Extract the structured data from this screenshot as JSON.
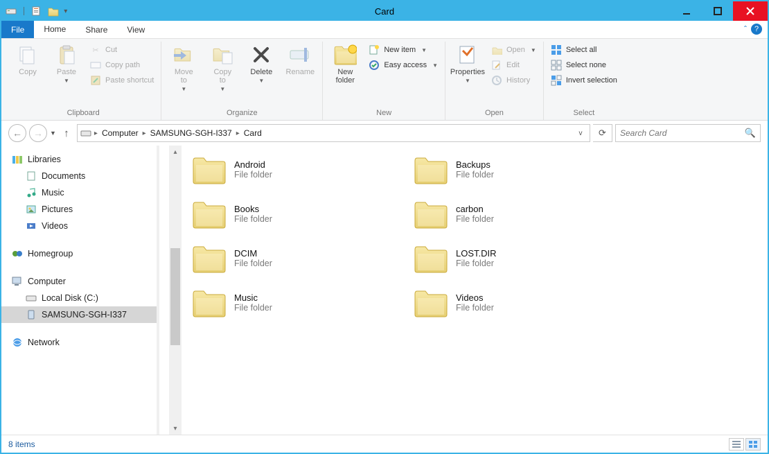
{
  "window": {
    "title": "Card"
  },
  "tabs": {
    "file": "File",
    "home": "Home",
    "share": "Share",
    "view": "View"
  },
  "ribbon": {
    "clipboard": {
      "label": "Clipboard",
      "copy": "Copy",
      "paste": "Paste",
      "cut": "Cut",
      "copy_path": "Copy path",
      "paste_shortcut": "Paste shortcut"
    },
    "organize": {
      "label": "Organize",
      "move_to": "Move\nto",
      "copy_to": "Copy\nto",
      "delete": "Delete",
      "rename": "Rename"
    },
    "new": {
      "label": "New",
      "new_folder": "New\nfolder",
      "new_item": "New item",
      "easy_access": "Easy access"
    },
    "open": {
      "label": "Open",
      "properties": "Properties",
      "open": "Open",
      "edit": "Edit",
      "history": "History"
    },
    "select": {
      "label": "Select",
      "select_all": "Select all",
      "select_none": "Select none",
      "invert": "Invert selection"
    }
  },
  "breadcrumb": {
    "root": "Computer",
    "device": "SAMSUNG-SGH-I337",
    "leaf": "Card"
  },
  "search": {
    "placeholder": "Search Card"
  },
  "nav": {
    "libraries": "Libraries",
    "documents": "Documents",
    "music": "Music",
    "pictures": "Pictures",
    "videos": "Videos",
    "homegroup": "Homegroup",
    "computer": "Computer",
    "local_disk": "Local Disk (C:)",
    "samsung": "SAMSUNG-SGH-I337",
    "network": "Network"
  },
  "folders": [
    {
      "name": "Android",
      "type": "File folder"
    },
    {
      "name": "Backups",
      "type": "File folder"
    },
    {
      "name": "Books",
      "type": "File folder"
    },
    {
      "name": "carbon",
      "type": "File folder"
    },
    {
      "name": "DCIM",
      "type": "File folder"
    },
    {
      "name": "LOST.DIR",
      "type": "File folder"
    },
    {
      "name": "Music",
      "type": "File folder"
    },
    {
      "name": "Videos",
      "type": "File folder"
    }
  ],
  "status": {
    "count": "8 items"
  }
}
